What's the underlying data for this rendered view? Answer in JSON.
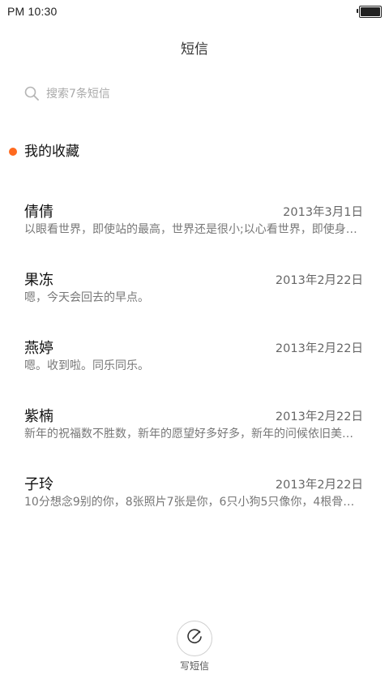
{
  "status_bar": {
    "time": "PM 10:30"
  },
  "header": {
    "title": "短信"
  },
  "search": {
    "placeholder": "搜索7条短信",
    "icon": "search-icon"
  },
  "favorites": {
    "label": "我的收藏"
  },
  "messages": [
    {
      "name": "倩倩",
      "date": "2013年3月1日",
      "preview": "以眼看世界，即使站的最高，世界还是很小;以心看世界，即使身…",
      "unread": false
    },
    {
      "name": "果冻",
      "date": "2013年2月22日",
      "preview": "嗯，今天会回去的早点。",
      "unread": false
    },
    {
      "name": "燕婷",
      "date": "2013年2月22日",
      "preview": "嗯。收到啦。同乐同乐。",
      "unread": true
    },
    {
      "name": "紫楠",
      "date": "2013年2月22日",
      "preview": "新年的祝福数不胜数，新年的愿望好多好多，新年的问候依旧美…",
      "unread": false
    },
    {
      "name": "子玲",
      "date": "2013年2月22日",
      "preview": "10分想念9别的你，8张照片7张是你，6只小狗5只像你，4根骨…",
      "unread": false
    }
  ],
  "compose": {
    "label": "写短信",
    "icon": "compose-icon"
  },
  "colors": {
    "unread_dot": "#ff6a1f"
  }
}
